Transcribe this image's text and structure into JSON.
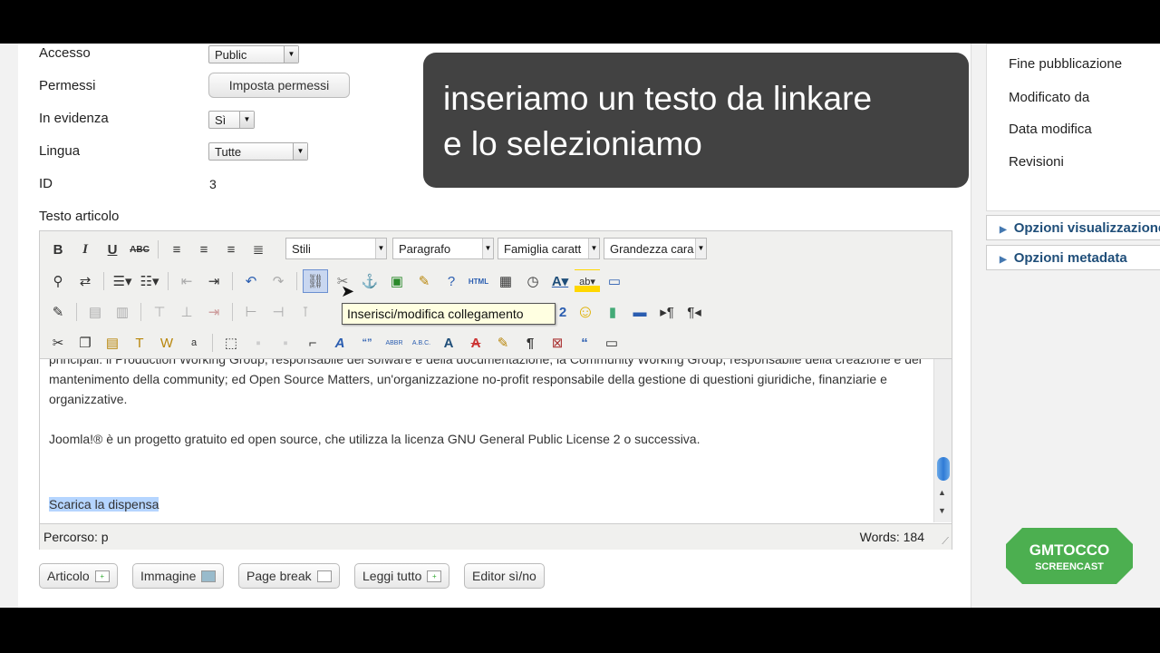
{
  "form": {
    "fields": [
      {
        "label": "Accesso",
        "value": "Public"
      },
      {
        "label": "Permessi",
        "value": "Imposta permessi"
      },
      {
        "label": "In evidenza",
        "value": "Sì"
      },
      {
        "label": "Lingua",
        "value": "Tutte"
      },
      {
        "label": "ID",
        "value": "3"
      }
    ],
    "article_label": "Testo articolo"
  },
  "editor": {
    "toolbar": {
      "style_select": "Stili",
      "paragraph_select": "Paragrafo",
      "font_family_select": "Famiglia caratt",
      "font_size_select": "Grandezza cara"
    },
    "tooltip": "Inserisci/modifica collegamento",
    "content": {
      "para1": "principali: il Production Working Group, responsabile del sofware e della documentazione; la Community Working Group, responsabile della creazione e del mantenimento della community; ed Open Source Matters, un'organizzazione no-profit responsabile della gestione di questioni giuridiche, finanziarie e organizzative.",
      "para2": "Joomla!® è un progetto gratuito ed open source, che utilizza la licenza GNU General Public License 2 o successiva.",
      "selected_text": "Scarica la dispensa"
    },
    "status": {
      "path": "Percorso: p",
      "words": "Words: 184"
    }
  },
  "buttons": {
    "article": "Articolo",
    "image": "Immagine",
    "page_break": "Page break",
    "read_more": "Leggi tutto",
    "editor_toggle": "Editor sì/no"
  },
  "overlay": {
    "line1": "inseriamo un testo da linkare",
    "line2": "e lo selezioniamo"
  },
  "right_panel": {
    "labels": [
      "Fine pubblicazione",
      "Modificato da",
      "Data modifica",
      "Revisioni"
    ],
    "options": [
      "Opzioni visualizzazione",
      "Opzioni metadata"
    ]
  },
  "logo": {
    "line1": "GMTOCCO",
    "line2": "SCREENCAST"
  },
  "colors": {
    "selection": "#b5d5ff",
    "option_text": "#1f4e79",
    "logo_green": "#4caf50"
  }
}
